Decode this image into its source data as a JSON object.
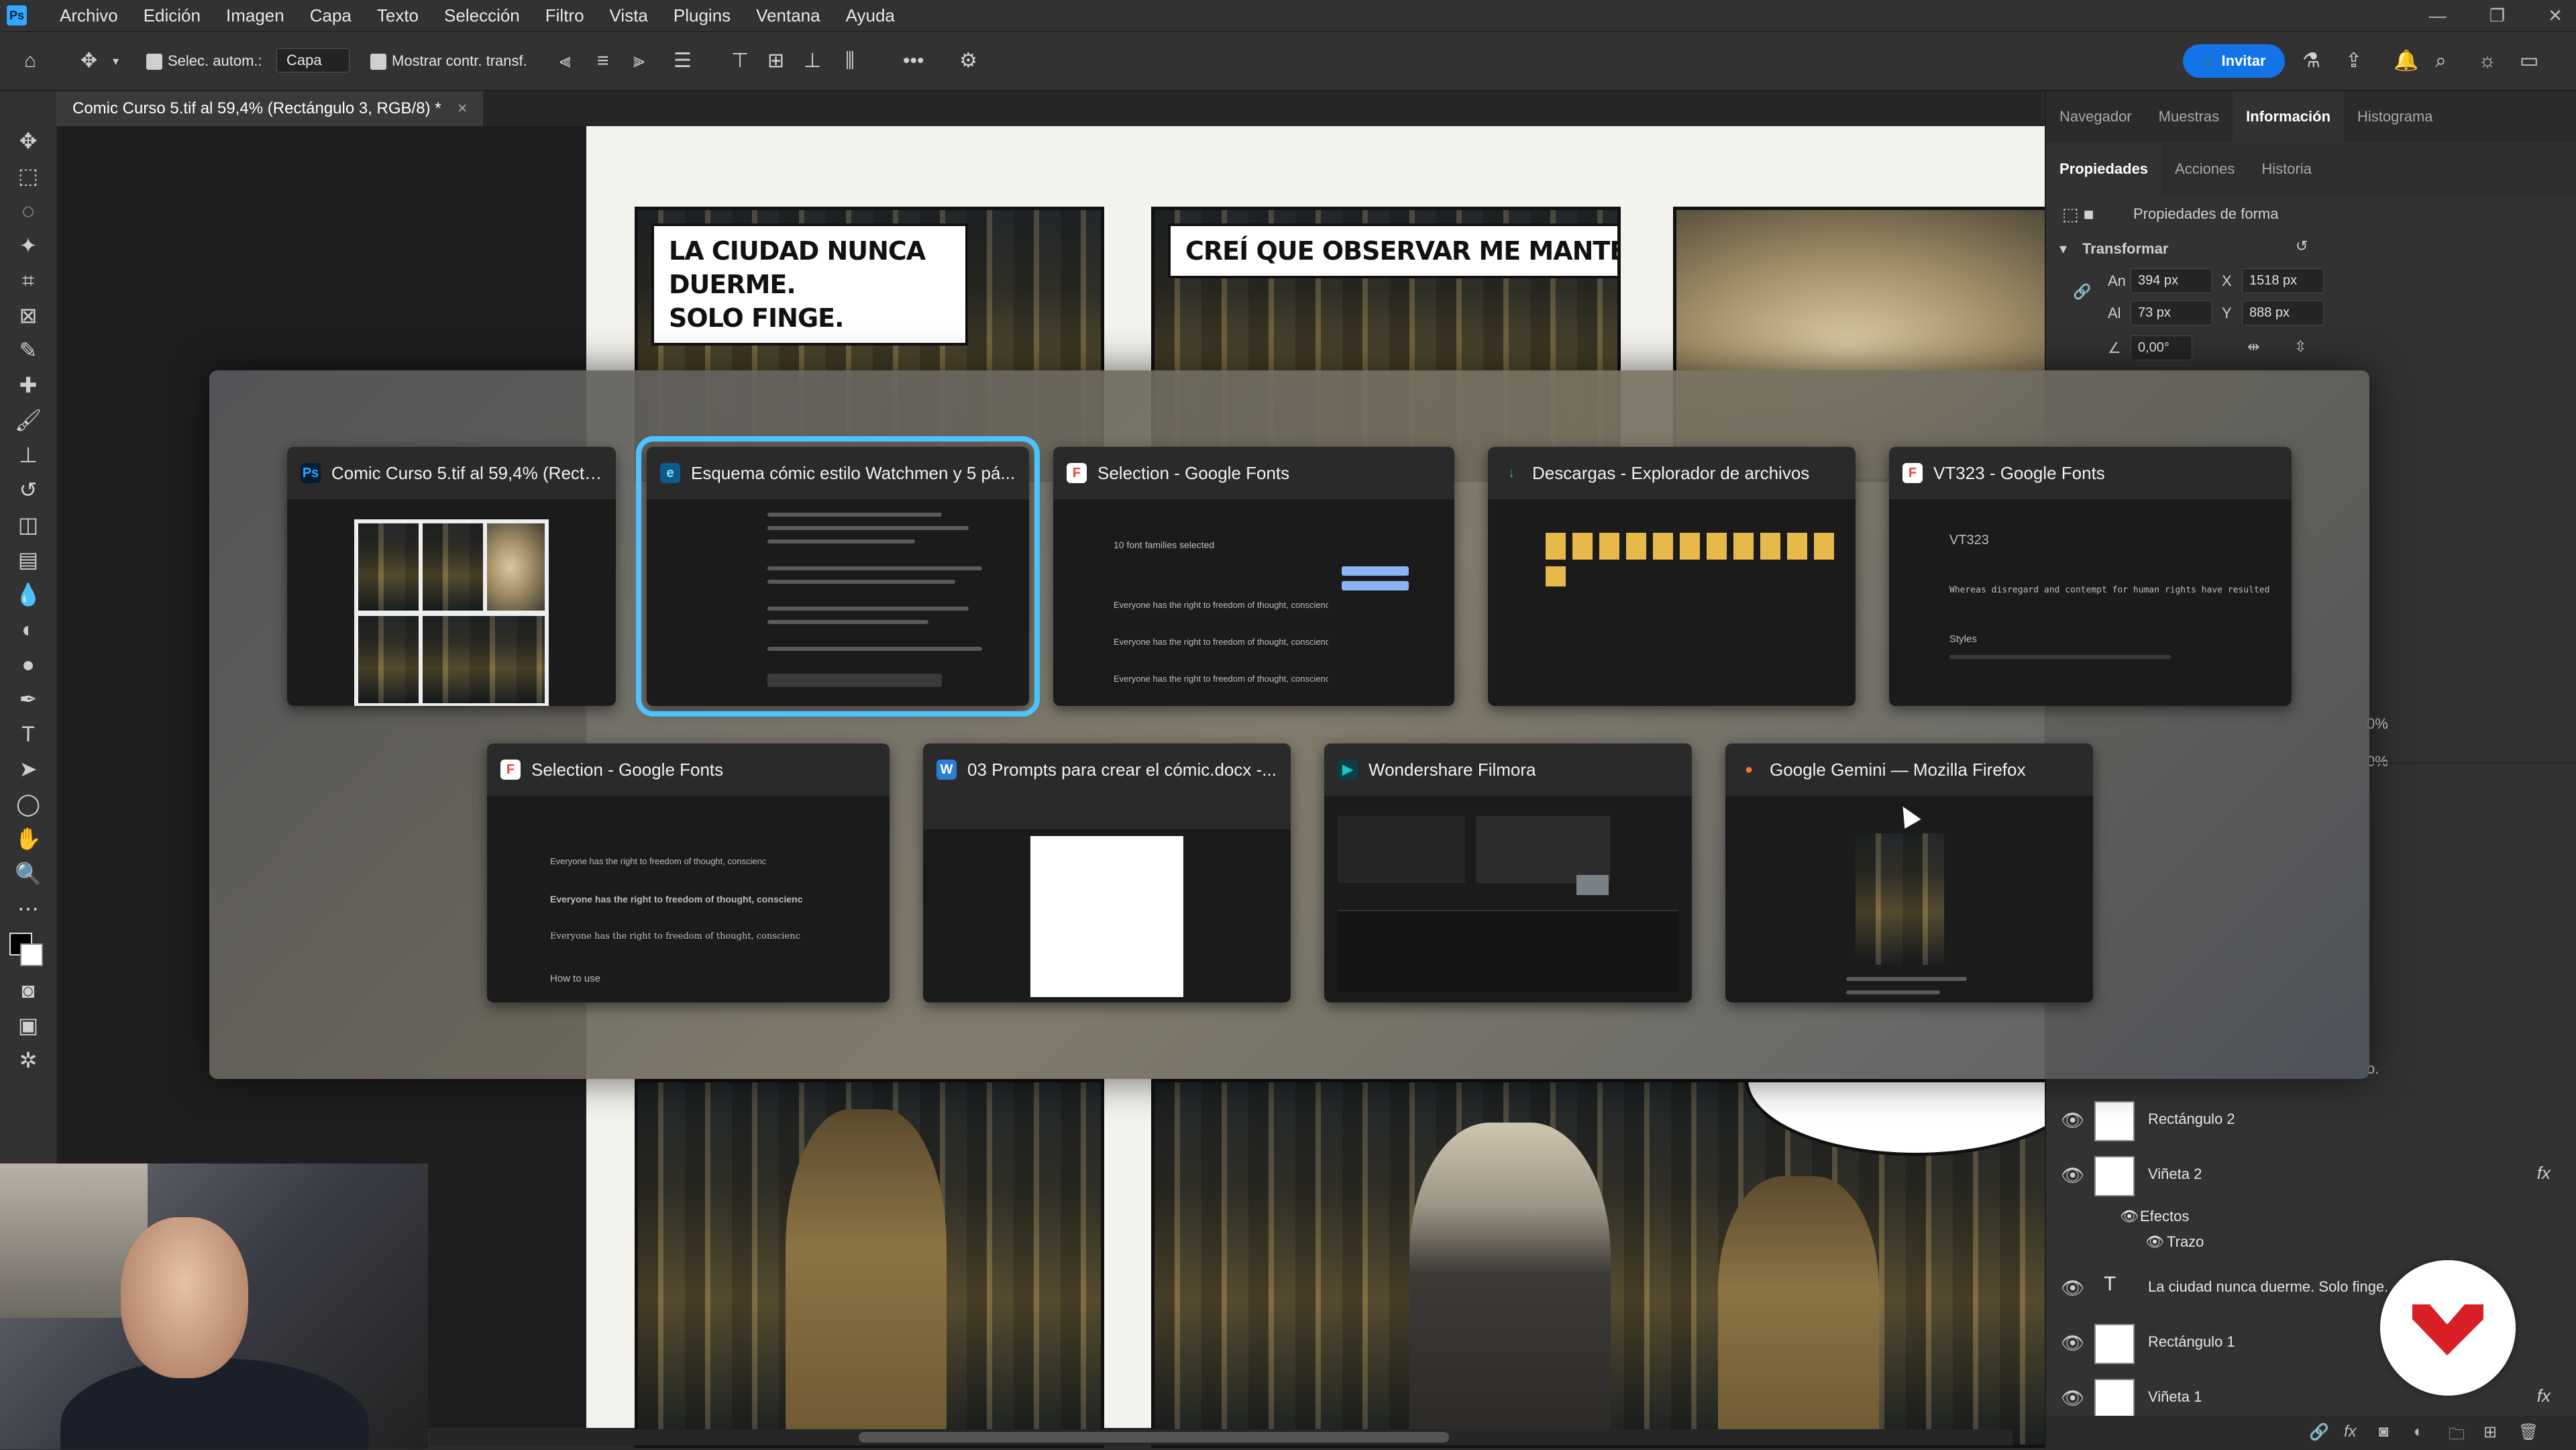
{
  "app": {
    "name": "Photoshop",
    "menu": [
      "Archivo",
      "Edición",
      "Imagen",
      "Capa",
      "Texto",
      "Selección",
      "Filtro",
      "Vista",
      "Plugins",
      "Ventana",
      "Ayuda"
    ]
  },
  "options_bar": {
    "auto_select_label": "Selec. autom.:",
    "auto_select_value": "Capa",
    "show_transform_label": "Mostrar contr. transf.",
    "invite_label": "Invitar"
  },
  "document_tab": {
    "title": "Comic Curso 5.tif al 59,4% (Rectángulo 3, RGB/8) *",
    "close": "×"
  },
  "comic": {
    "caption1_line1": "LA CIUDAD NUNCA DUERME.",
    "caption1_line2": "SOLO FINGE.",
    "caption2": "CREÍ QUE OBSERVAR ME MANTENÍA A SALVO."
  },
  "right_panel": {
    "top_tabs": [
      "Navegador",
      "Muestras",
      "Información",
      "Histograma"
    ],
    "top_active": "Información",
    "sub_tabs": [
      "Propiedades",
      "Acciones",
      "Historia"
    ],
    "sub_active": "Propiedades",
    "shape_props_label": "Propiedades de forma",
    "transform_label": "Transformar",
    "w_label": "An",
    "w_value": "394 px",
    "x_label": "X",
    "x_value": "1518 px",
    "h_label": "Al",
    "h_value": "73 px",
    "y_label": "Y",
    "y_value": "888 px",
    "angle_value": "0,00°",
    "opacity_a": "0%",
    "opacity_b": "0%",
    "partial_text": "o."
  },
  "layers": [
    {
      "name": "Rectángulo 2",
      "kind": "shape",
      "fx": false
    },
    {
      "name": "Viñeta 2",
      "kind": "pixel",
      "fx": true
    },
    {
      "name": "Efectos",
      "kind": "effects",
      "fx": false
    },
    {
      "name": "Trazo",
      "kind": "effect",
      "fx": false
    },
    {
      "name": "La ciudad nunca duerme.  Solo finge.",
      "kind": "text",
      "fx": false
    },
    {
      "name": "Rectángulo 1",
      "kind": "shape",
      "fx": false
    },
    {
      "name": "Viñeta 1",
      "kind": "pixel",
      "fx": true
    }
  ],
  "fx_label": "fx",
  "switcher": {
    "windows": [
      {
        "title": "Comic Curso 5.tif al 59,4% (Rectán...",
        "icon": "photoshop-icon",
        "icon_text": "Ps",
        "icon_color": "#31a8ff",
        "selected": false
      },
      {
        "title": "Esquema cómic estilo Watchmen y 5 pá...",
        "icon": "edge-icon",
        "icon_text": "e",
        "icon_color": "#1fa2e8",
        "selected": true
      },
      {
        "title": "Selection - Google Fonts",
        "icon": "google-fonts-icon",
        "icon_text": "F",
        "icon_color": "#ea4335",
        "selected": false
      },
      {
        "title": "Descargas - Explorador de archivos",
        "icon": "download-icon",
        "icon_text": "↓",
        "icon_color": "#2fbf71",
        "selected": false
      },
      {
        "title": "VT323 - Google Fonts",
        "icon": "google-fonts-icon",
        "icon_text": "F",
        "icon_color": "#ea4335",
        "selected": false
      },
      {
        "title": "Selection - Google Fonts",
        "icon": "google-fonts-icon",
        "icon_text": "F",
        "icon_color": "#ea4335",
        "selected": false
      },
      {
        "title": "03 Prompts para crear el cómic.docx -...",
        "icon": "word-icon",
        "icon_text": "W",
        "icon_color": "#2b7cd3",
        "selected": false
      },
      {
        "title": "Wondershare Filmora",
        "icon": "filmora-icon",
        "icon_text": "▶",
        "icon_color": "#1bc4c4",
        "selected": false
      },
      {
        "title": "Google Gemini — Mozilla Firefox",
        "icon": "firefox-icon",
        "icon_text": "●",
        "icon_color": "#ff7139",
        "selected": false
      }
    ],
    "thumb_texts": {
      "fonts_selected": "10 font families selected",
      "fonts_sample": "Everyone has the right to freedom of thought, conscienc",
      "vt323_name": "VT323",
      "vt323_sample": "Whereas disregard and contempt for human rights have resulted",
      "vt323_styles": "Styles",
      "how_to_use": "How to use"
    }
  },
  "colors": {
    "accent": "#4cc2ff",
    "invite": "#1473e6",
    "brand": "#d81f26"
  }
}
